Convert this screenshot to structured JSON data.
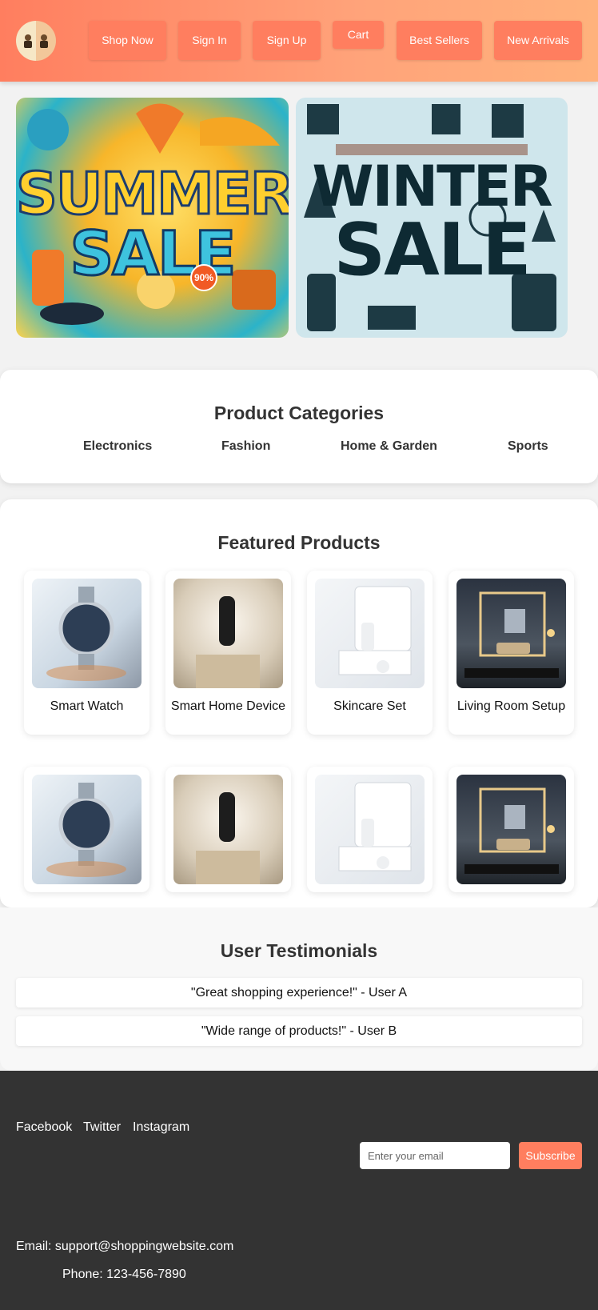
{
  "header": {
    "nav": [
      "Shop Now",
      "Sign In",
      "Sign Up",
      "Cart",
      "Best Sellers",
      "New Arrivals"
    ]
  },
  "banners": {
    "summer": {
      "line1": "SUMMER",
      "line2": "SALE",
      "badge": "90%"
    },
    "winter": {
      "line1": "WINTER",
      "line2": "SALE"
    }
  },
  "categories": {
    "title": "Product Categories",
    "items": [
      "Electronics",
      "Fashion",
      "Home & Garden",
      "Sports"
    ]
  },
  "featured": {
    "title": "Featured Products",
    "products": [
      "Smart Watch",
      "Smart Home Device",
      "Skincare Set",
      "Living Room Setup"
    ]
  },
  "testimonials": {
    "title": "User Testimonials",
    "items": [
      "\"Great shopping experience!\" - User A",
      "\"Wide range of products!\" - User B"
    ]
  },
  "footer": {
    "social": [
      "Facebook",
      "Twitter",
      "Instagram"
    ],
    "email_placeholder": "Enter your email",
    "subscribe": "Subscribe",
    "email": "Email: support@shoppingwebsite.com",
    "phone": "Phone: 123-456-7890"
  },
  "colors": {
    "accent": "#ff7e5f",
    "footer_bg": "#333333"
  }
}
